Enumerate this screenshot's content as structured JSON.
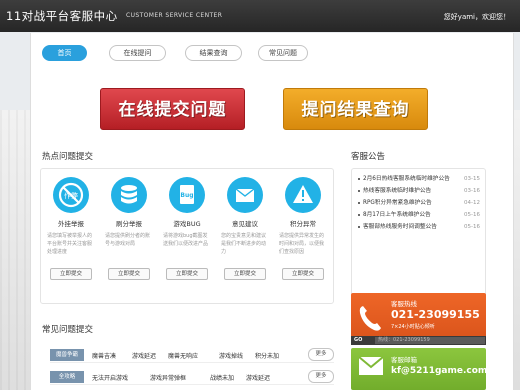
{
  "header": {
    "logo": "11对战平台客服中心",
    "logo_sub": "CUSTOMER SERVICE CENTER",
    "welcome": "您好yami，欢迎您！"
  },
  "nav": [
    {
      "label": "首页"
    },
    {
      "label": "在线提问"
    },
    {
      "label": "结果查询"
    },
    {
      "label": "常见问题"
    }
  ],
  "actions": {
    "submit": "在线提交问题",
    "query": "提问结果查询"
  },
  "hot": {
    "title": "热点问题提交",
    "items": [
      {
        "name": "外挂举报",
        "desc": "请您填写被举报人的平台账号并关注客服处理进度",
        "button": "立即提交"
      },
      {
        "name": "刷分举报",
        "desc": "请您提供刷分者的账号与游戏对局",
        "button": "立即提交"
      },
      {
        "name": "游戏BUG",
        "desc": "请将游戏bug截图发送我们以便改进产品",
        "button": "立即提交"
      },
      {
        "name": "意见建议",
        "desc": "您的宝贵意见和建议是我们不断进步的动力",
        "button": "立即提交"
      },
      {
        "name": "积分异常",
        "desc": "请您提供异常发生的时间和对局，以便我们查找原因",
        "button": "立即提交"
      }
    ]
  },
  "notice": {
    "title": "客服公告",
    "items": [
      {
        "text": "2月6日热线客服系统临时维护公告",
        "date": "03-15"
      },
      {
        "text": "热线客服系统临时维护公告",
        "date": "03-16"
      },
      {
        "text": "RPG积分异常紧急维护公告",
        "date": "04-12"
      },
      {
        "text": "8月17日上午系统维护公告",
        "date": "05-16"
      },
      {
        "text": "客服部热线服务时间调整公告",
        "date": "05-16"
      }
    ]
  },
  "faq": {
    "title": "常见问题提交",
    "rows": [
      {
        "tag": "魔兽争霸",
        "links": [
          "魔兽吉凑",
          "游戏延迟",
          "魔兽无响应",
          "游戏掉线",
          "积分未加"
        ],
        "more": "更多"
      },
      {
        "tag": "全攻略",
        "links": [
          "无法开启游戏",
          "游戏异常弹框",
          "战绩未加",
          "游戏延迟"
        ],
        "more": "更多"
      }
    ]
  },
  "hotline": {
    "label": "客服热线",
    "number": "021-23099155",
    "hours": "7×24小时贴心倾听",
    "go": "GO",
    "input_value": "热线：021-23099159"
  },
  "email": {
    "label": "客服邮箱",
    "address": "kf@5211game.com"
  },
  "colors": {
    "header": "#2c2c2c",
    "accent": "#2aa0dd",
    "red": "#c8282f",
    "orange": "#e89a16",
    "hotline": "#e45e22",
    "email": "#7fb936",
    "icon": "#22b2e6"
  }
}
